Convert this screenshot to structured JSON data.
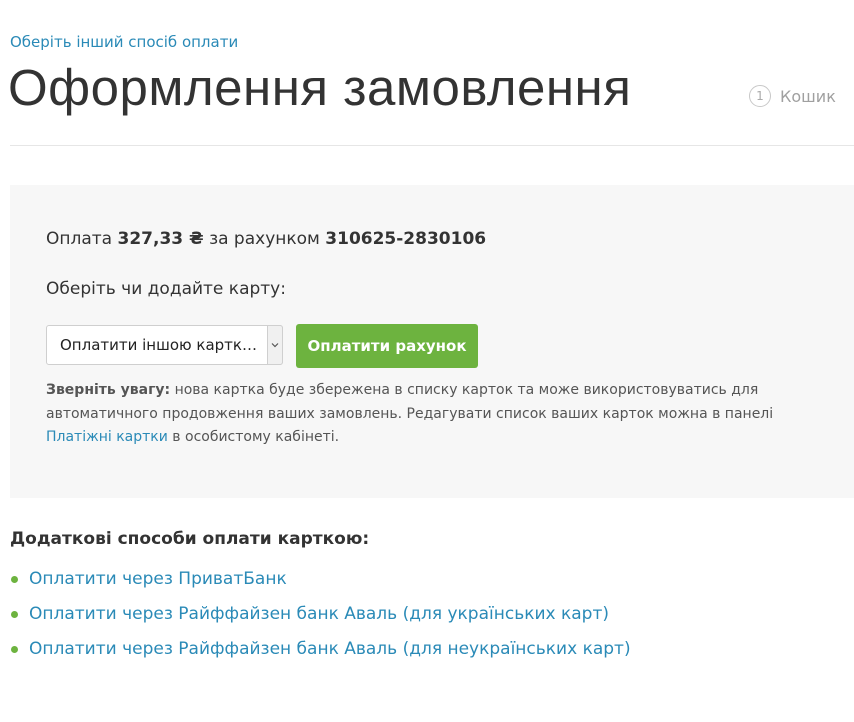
{
  "header": {
    "back_link": "Оберіть інший спосіб оплати",
    "title": "Оформлення замовлення",
    "step": {
      "number": "1",
      "label": "Кошик"
    }
  },
  "payment": {
    "prefix": "Оплата",
    "amount": "327,33 ₴",
    "middle": "за рахунком",
    "invoice": "310625-2830106",
    "choose_label": "Оберіть чи додайте карту:",
    "card_select_value": "Оплатити іншою карткою...",
    "pay_button": "Оплатити рахунок",
    "notice_bold": "Зверніть увагу:",
    "notice_text": "нова картка буде збережена в списку карток та може використовуватись для автоматичного продовження ваших замовлень. Редагувати список ваших карток можна в панелі",
    "notice_link": "Платіжні картки",
    "notice_tail": "в особистому кабінеті."
  },
  "alternatives": {
    "heading": "Додаткові способи оплати карткою:",
    "items": [
      {
        "label": "Оплатити через ПриватБанк"
      },
      {
        "label": "Оплатити через Райффайзен банк Аваль (для українських карт)"
      },
      {
        "label": "Оплатити через Райффайзен банк Аваль (для неукраїнських карт)"
      }
    ]
  },
  "colors": {
    "accent_link": "#2a8ab7",
    "button_green": "#6db33f",
    "panel_bg": "#f7f7f7"
  },
  "icons": {
    "select_arrow": "chevron-down-icon",
    "bullet": "bullet-dot-icon"
  }
}
